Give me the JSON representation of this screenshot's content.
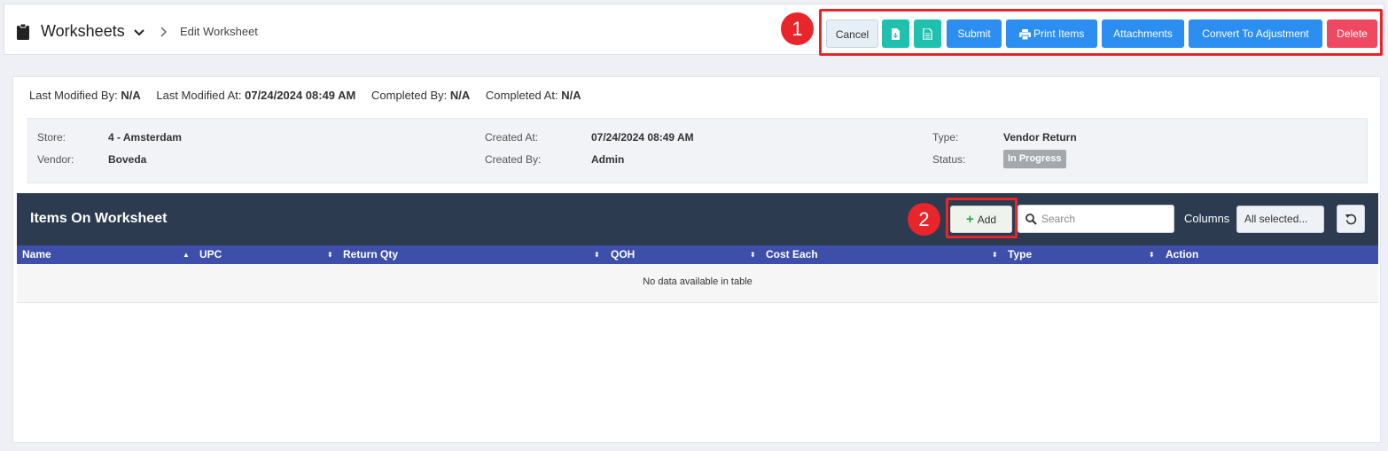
{
  "header": {
    "title": "Worksheets",
    "breadcrumb": "Edit Worksheet"
  },
  "toolbar": {
    "cancel": "Cancel",
    "submit": "Submit",
    "print_items": "Print Items",
    "attachments": "Attachments",
    "convert": "Convert To Adjustment",
    "delete": "Delete"
  },
  "markers": {
    "one": "1",
    "two": "2"
  },
  "meta": {
    "last_modified_by_label": "Last Modified By:",
    "last_modified_by": "N/A",
    "last_modified_at_label": "Last Modified At:",
    "last_modified_at": "07/24/2024 08:49 AM",
    "completed_by_label": "Completed By:",
    "completed_by": "N/A",
    "completed_at_label": "Completed At:",
    "completed_at": "N/A"
  },
  "info": {
    "store_label": "Store:",
    "store": "4 - Amsterdam",
    "vendor_label": "Vendor:",
    "vendor": "Boveda",
    "created_at_label": "Created At:",
    "created_at": "07/24/2024 08:49 AM",
    "created_by_label": "Created By:",
    "created_by": "Admin",
    "type_label": "Type:",
    "type": "Vendor Return",
    "status_label": "Status:",
    "status": "In Progress"
  },
  "items": {
    "title": "Items On Worksheet",
    "add": "Add",
    "search_placeholder": "Search",
    "columns_label": "Columns",
    "columns_value": "All selected...",
    "headers": [
      "Name",
      "UPC",
      "Return Qty",
      "QOH",
      "Cost Each",
      "Type",
      "Action"
    ],
    "empty": "No data available in table"
  },
  "colors": {
    "accent_blue": "#2b8ef0",
    "teal": "#1fc0ae",
    "danger": "#ee4862",
    "header_dark": "#2c3b4f",
    "table_header": "#3d4fa9",
    "annotation_red": "#e8252b"
  }
}
